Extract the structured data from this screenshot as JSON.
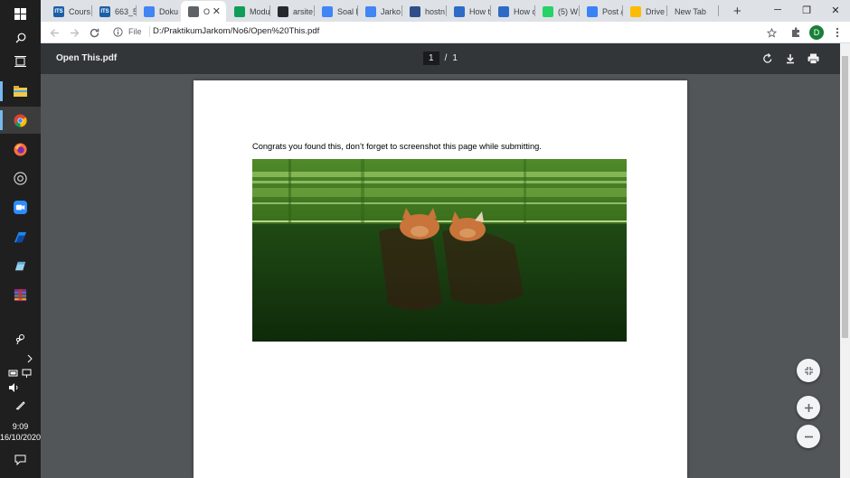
{
  "taskbar": {
    "icons": [
      "windows-start-icon",
      "search-icon",
      "task-view-icon",
      "file-explorer-icon",
      "chrome-icon",
      "firefox-icon",
      "camera-icon",
      "zoom-icon",
      "edge-icon",
      "notes-icon",
      "winrar-icon",
      "people-icon"
    ],
    "clock": {
      "time": "9:09",
      "date": "16/10/2020"
    }
  },
  "browser": {
    "tabs": [
      {
        "label": "Cours",
        "favicon_text": "ITS",
        "favicon_color": "#1b5fa8"
      },
      {
        "label": "663_5",
        "favicon_text": "ITS",
        "favicon_color": "#1b5fa8"
      },
      {
        "label": "Doku",
        "favicon_text": "",
        "favicon_color": "#4285f4"
      },
      {
        "label": "O",
        "favicon_text": "",
        "favicon_color": "#5f6368",
        "active": true
      },
      {
        "label": "Modu",
        "favicon_text": "",
        "favicon_color": "#0f9d58"
      },
      {
        "label": "arsite",
        "favicon_text": "",
        "favicon_color": "#24292e"
      },
      {
        "label": "Soal F",
        "favicon_text": "",
        "favicon_color": "#4285f4"
      },
      {
        "label": "Jarko",
        "favicon_text": "",
        "favicon_color": "#4285f4"
      },
      {
        "label": "hostn",
        "favicon_text": "",
        "favicon_color": "#2f4f88"
      },
      {
        "label": "How t",
        "favicon_text": "",
        "favicon_color": "#2e6bc6"
      },
      {
        "label": "How c",
        "favicon_text": "",
        "favicon_color": "#2e6bc6"
      },
      {
        "label": "(5) W",
        "favicon_text": "",
        "favicon_color": "#25d366"
      },
      {
        "label": "Post /",
        "favicon_text": "",
        "favicon_color": "#3b82f6"
      },
      {
        "label": "Drive",
        "favicon_text": "",
        "favicon_color": "#fbbc04"
      },
      {
        "label": "New Tab",
        "favicon_text": "",
        "favicon_color": ""
      }
    ],
    "new_tab": "+",
    "window_controls": {
      "minimize": "─",
      "restore": "❐",
      "close": "✕"
    },
    "address": {
      "info_label": "File",
      "url": "D:/PraktikumJarkom/No6/Open%20This.pdf"
    },
    "profile_initial": "D"
  },
  "pdf": {
    "title": "Open This.pdf",
    "current_page": "1",
    "separator": "/",
    "total_pages": "1",
    "body_text": "Congrats you found this, don’t forget to screenshot this page while submitting."
  },
  "colors": {
    "taskbar": "#1f1f1f",
    "pdf_toolbar": "#323639",
    "pdf_background": "#525659",
    "accent": "#76b9ed"
  }
}
